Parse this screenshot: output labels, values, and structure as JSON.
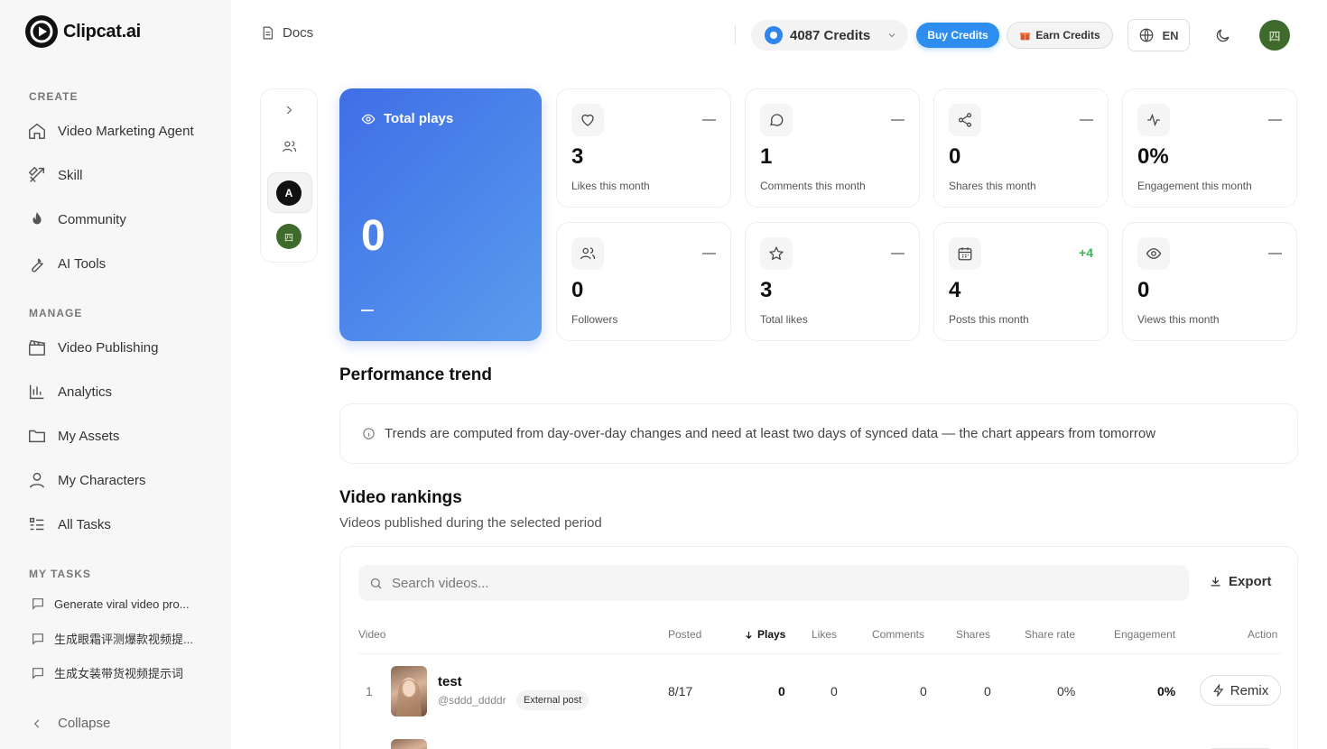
{
  "app": {
    "name": "Clipcat.ai"
  },
  "sidebar": {
    "create_title": "CREATE",
    "create_items": [
      {
        "label": "Video Marketing Agent",
        "icon": "home-icon"
      },
      {
        "label": "Skill",
        "icon": "tools-icon"
      },
      {
        "label": "Community",
        "icon": "flame-icon"
      },
      {
        "label": "AI Tools",
        "icon": "wrench-icon"
      }
    ],
    "manage_title": "MANAGE",
    "manage_items": [
      {
        "label": "Video Publishing",
        "icon": "clapperboard-icon"
      },
      {
        "label": "Analytics",
        "icon": "bar-chart-icon"
      },
      {
        "label": "My Assets",
        "icon": "folder-icon"
      },
      {
        "label": "My Characters",
        "icon": "user-icon"
      },
      {
        "label": "All Tasks",
        "icon": "list-icon"
      }
    ],
    "tasks_title": "MY TASKS",
    "tasks": [
      {
        "label": "Generate viral video pro..."
      },
      {
        "label": "生成眼霜评测爆款视频提..."
      },
      {
        "label": "生成女装带货视频提示词"
      }
    ],
    "collapse_label": "Collapse"
  },
  "topbar": {
    "docs_label": "Docs",
    "credits_label": "4087 Credits",
    "buy_label": "Buy Credits",
    "earn_label": "Earn Credits",
    "lang_label": "EN",
    "avatar_glyph": "四"
  },
  "rail": {
    "account_initial": "A",
    "avatar_glyph": "四"
  },
  "hero": {
    "label": "Total plays",
    "value": "0",
    "trend": "—"
  },
  "stats": [
    {
      "value": "3",
      "label": "Likes this month",
      "icon": "heart-icon",
      "delta": ""
    },
    {
      "value": "1",
      "label": "Comments this month",
      "icon": "comment-icon",
      "delta": ""
    },
    {
      "value": "0",
      "label": "Shares this month",
      "icon": "share-icon",
      "delta": ""
    },
    {
      "value": "0%",
      "label": "Engagement this month",
      "icon": "activity-icon",
      "delta": ""
    },
    {
      "value": "0",
      "label": "Followers",
      "icon": "users-icon",
      "delta": ""
    },
    {
      "value": "3",
      "label": "Total likes",
      "icon": "star-icon",
      "delta": ""
    },
    {
      "value": "4",
      "label": "Posts this month",
      "icon": "calendar-icon",
      "delta": "+4"
    },
    {
      "value": "0",
      "label": "Views this month",
      "icon": "eye-icon",
      "delta": ""
    }
  ],
  "trend": {
    "title": "Performance trend",
    "notice": "Trends are computed from day-over-day changes and need at least two days of synced data — the chart appears from tomorrow"
  },
  "rankings": {
    "title": "Video rankings",
    "subtitle": "Videos published during the selected period",
    "search_placeholder": "Search videos...",
    "export_label": "Export",
    "columns": {
      "video": "Video",
      "posted": "Posted",
      "plays": "Plays",
      "likes": "Likes",
      "comments": "Comments",
      "shares": "Shares",
      "share_rate": "Share rate",
      "engagement": "Engagement",
      "action": "Action"
    },
    "rows": [
      {
        "rank": "1",
        "title": "test",
        "handle": "@sddd_ddddr",
        "badge": "External post",
        "posted": "8/17",
        "plays": "0",
        "likes": "0",
        "comments": "0",
        "shares": "0",
        "share_rate": "0%",
        "engagement": "0%",
        "action": "Remix"
      }
    ]
  },
  "colors": {
    "accent": "#2d8ef0",
    "hero_start": "#3f6ee6",
    "hero_end": "#5a9cee",
    "positive": "#3fb25a",
    "avatar_bg": "#3e6b2c"
  }
}
